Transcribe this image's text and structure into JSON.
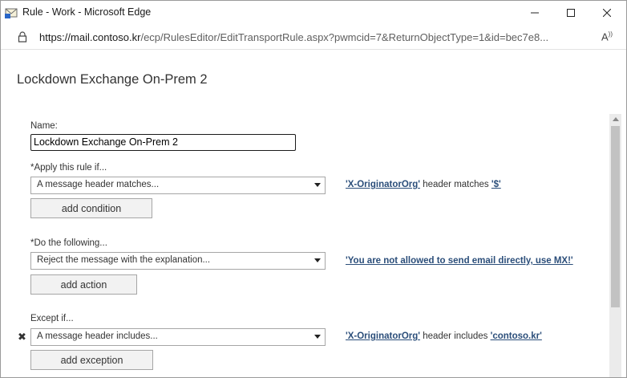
{
  "window": {
    "title": "Rule - Work - Microsoft Edge",
    "url_host": "https://mail.contoso.kr",
    "url_path": "/ecp/RulesEditor/EditTransportRule.aspx?pwmcid=7&ReturnObjectType=1&id=bec7e8..."
  },
  "page": {
    "title": "Lockdown Exchange On-Prem 2",
    "name_label": "Name:",
    "name_value": "Lockdown Exchange On-Prem 2",
    "condition": {
      "label": "*Apply this rule if...",
      "selected": "A message header matches...",
      "button": "add condition",
      "desc_link1": "'X-OriginatorOrg'",
      "desc_text": " header matches ",
      "desc_link2": "'$'"
    },
    "action": {
      "label": "*Do the following...",
      "selected": "Reject the message with the explanation...",
      "button": "add action",
      "desc_link1": "'You are not allowed to send email directly, use MX!'"
    },
    "exception": {
      "label": "Except if...",
      "selected": "A message header includes...",
      "button": "add exception",
      "desc_link1": "'X-OriginatorOrg'",
      "desc_text": " header includes ",
      "desc_link2": "'contoso.kr'",
      "remove_glyph": "✖"
    }
  },
  "colors": {
    "link": "#2b4e7a",
    "button_bg": "#f2f2f2",
    "border": "#a6a6a6"
  }
}
